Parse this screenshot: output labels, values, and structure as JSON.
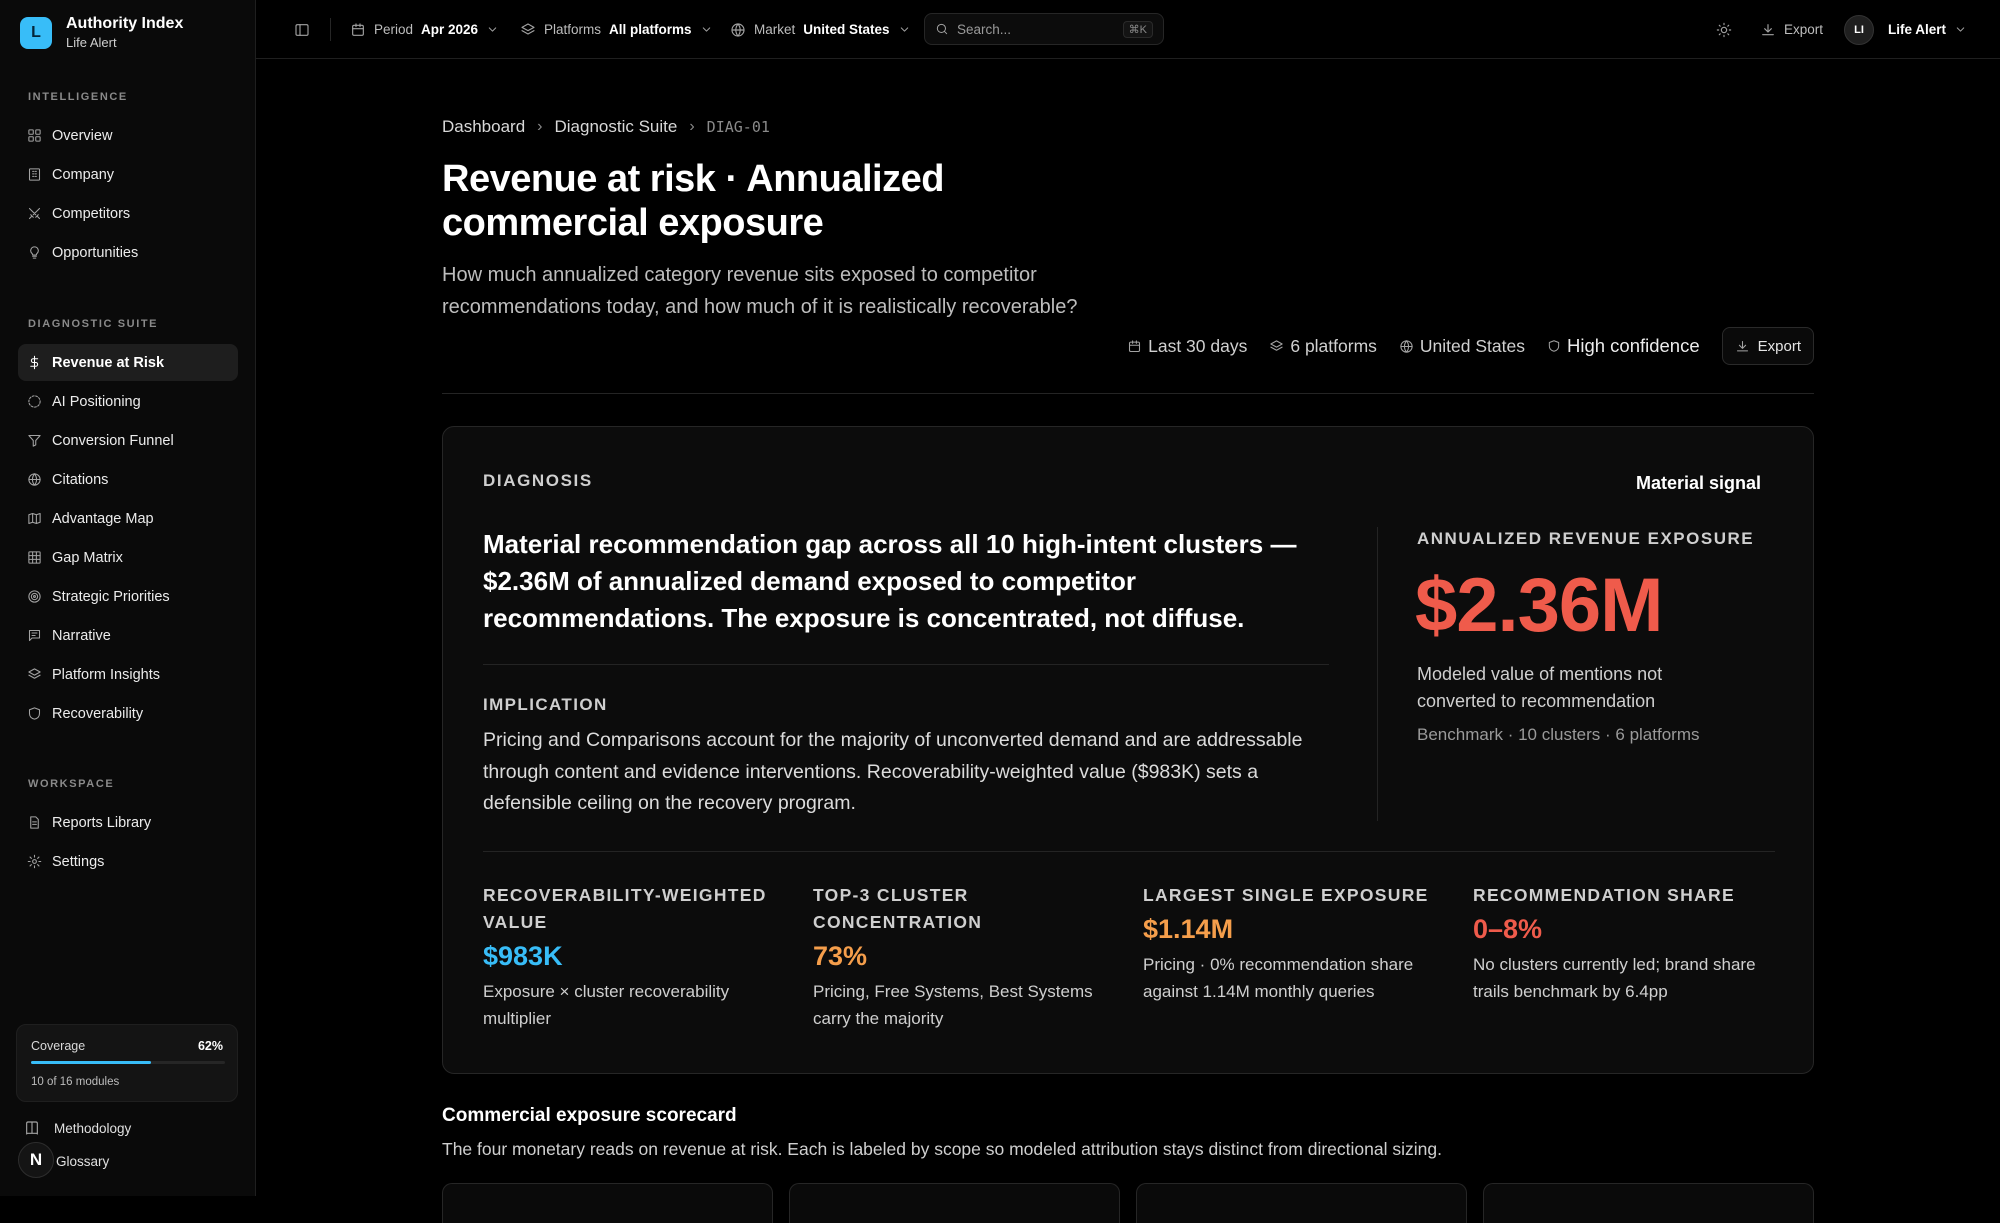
{
  "brand": {
    "initial": "L",
    "name": "Authority Index",
    "client": "Life Alert"
  },
  "sidebar": {
    "sections": [
      {
        "heading": "INTELLIGENCE",
        "items": [
          {
            "label": "Overview",
            "icon": "grid-icon"
          },
          {
            "label": "Company",
            "icon": "building-icon"
          },
          {
            "label": "Competitors",
            "icon": "swords-icon"
          },
          {
            "label": "Opportunities",
            "icon": "lightbulb-icon"
          }
        ]
      },
      {
        "heading": "DIAGNOSTIC SUITE",
        "items": [
          {
            "label": "Revenue at Risk",
            "icon": "dollar-icon",
            "active": true
          },
          {
            "label": "AI Positioning",
            "icon": "circle-dashed-icon"
          },
          {
            "label": "Conversion Funnel",
            "icon": "funnel-icon"
          },
          {
            "label": "Citations",
            "icon": "globe-icon"
          },
          {
            "label": "Advantage Map",
            "icon": "map-icon"
          },
          {
            "label": "Gap Matrix",
            "icon": "table-icon"
          },
          {
            "label": "Strategic Priorities",
            "icon": "target-icon"
          },
          {
            "label": "Narrative",
            "icon": "message-icon"
          },
          {
            "label": "Platform Insights",
            "icon": "layers-icon"
          },
          {
            "label": "Recoverability",
            "icon": "shield-icon"
          }
        ]
      },
      {
        "heading": "WORKSPACE",
        "items": [
          {
            "label": "Reports Library",
            "icon": "document-icon"
          },
          {
            "label": "Settings",
            "icon": "gear-icon"
          }
        ]
      }
    ],
    "coverage": {
      "label": "Coverage",
      "percent_text": "62%",
      "percent": 0.62,
      "footer": "10 of 16 modules"
    },
    "footer": {
      "methodology": "Methodology",
      "glossary": "Glossary",
      "badge": "N"
    }
  },
  "topbar": {
    "period": {
      "label": "Period",
      "value": "Apr 2026"
    },
    "platforms": {
      "label": "Platforms",
      "value": "All platforms"
    },
    "market": {
      "label": "Market",
      "value": "United States"
    },
    "search": {
      "placeholder": "Search...",
      "shortcut": "⌘K"
    },
    "export": "Export",
    "user": {
      "initials": "LI",
      "name": "Life Alert"
    }
  },
  "page": {
    "breadcrumb": [
      "Dashboard",
      "Diagnostic Suite",
      "DIAG-01"
    ],
    "title": "Revenue at risk · Annualized commercial exposure",
    "subtitle": "How much annualized category revenue sits exposed to competitor recommendations today, and how much of it is realistically recoverable?",
    "meta": {
      "range": "Last 30 days",
      "platforms": "6 platforms",
      "market": "United States",
      "confidence": "High confidence",
      "export": "Export"
    }
  },
  "diagnosis": {
    "heading": "DIAGNOSIS",
    "signal": "Material signal",
    "headline": "Material recommendation gap across all 10 high-intent clusters — $2.36M of annualized demand exposed to competitor recommendations. The exposure is concentrated, not diffuse.",
    "implication_heading": "IMPLICATION",
    "implication": "Pricing and Comparisons account for the majority of unconverted demand and are addressable through content and evidence interventions. Recoverability-weighted value ($983K) sets a defensible ceiling on the recovery program.",
    "exposure": {
      "label": "ANNUALIZED REVENUE EXPOSURE",
      "value": "$2.36M",
      "description": "Modeled value of mentions not converted to recommendation",
      "benchmark": "Benchmark · 10 clusters · 6 platforms"
    },
    "kpis": [
      {
        "label": "RECOVERABILITY-WEIGHTED VALUE",
        "value": "$983K",
        "color": "#38bdf8",
        "desc": "Exposure × cluster recoverability multiplier"
      },
      {
        "label": "TOP-3 CLUSTER CONCENTRATION",
        "value": "73%",
        "color": "#f59e4b",
        "desc": "Pricing, Free Systems, Best Systems carry the majority"
      },
      {
        "label": "LARGEST SINGLE EXPOSURE",
        "value": "$1.14M",
        "color": "#f59e4b",
        "desc": "Pricing · 0% recommendation share against 1.14M monthly queries"
      },
      {
        "label": "RECOMMENDATION SHARE",
        "value": "0–8%",
        "color": "#ef5b4b",
        "desc": "No clusters currently led; brand share trails benchmark by 6.4pp"
      }
    ]
  },
  "scorecard": {
    "title": "Commercial exposure scorecard",
    "subtitle": "The four monetary reads on revenue at risk. Each is labeled by scope so modeled attribution stays distinct from directional sizing."
  },
  "colors": {
    "accent": "#38bdf8",
    "danger": "#ef5b4b",
    "warning": "#f59e4b"
  }
}
